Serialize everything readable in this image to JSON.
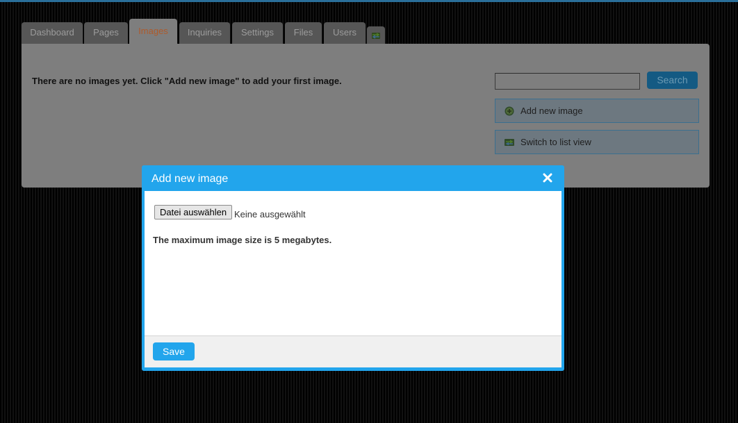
{
  "tabs": {
    "dashboard": "Dashboard",
    "pages": "Pages",
    "images": "Images",
    "inquiries": "Inquiries",
    "settings": "Settings",
    "files": "Files",
    "users": "Users",
    "switch_icon": "switch-icon"
  },
  "main": {
    "empty_message": "There are no images yet. Click \"Add new image\" to add your first image.",
    "search": {
      "value": "",
      "button_label": "Search"
    },
    "add_new_image_label": "Add new image",
    "add_new_image_icon": "add-circle-icon",
    "switch_view_label": "Switch to list view",
    "switch_view_icon": "list-switch-icon"
  },
  "modal": {
    "title": "Add new image",
    "close_icon": "close-icon",
    "file_button_label": "Datei auswählen",
    "file_status": "Keine ausgewählt",
    "max_size_note": "The maximum image size is 5 megabytes.",
    "save_label": "Save"
  },
  "colors": {
    "accent": "#22a5ec",
    "active_tab_text": "#ae5a2b",
    "search_button": "#145a83"
  }
}
